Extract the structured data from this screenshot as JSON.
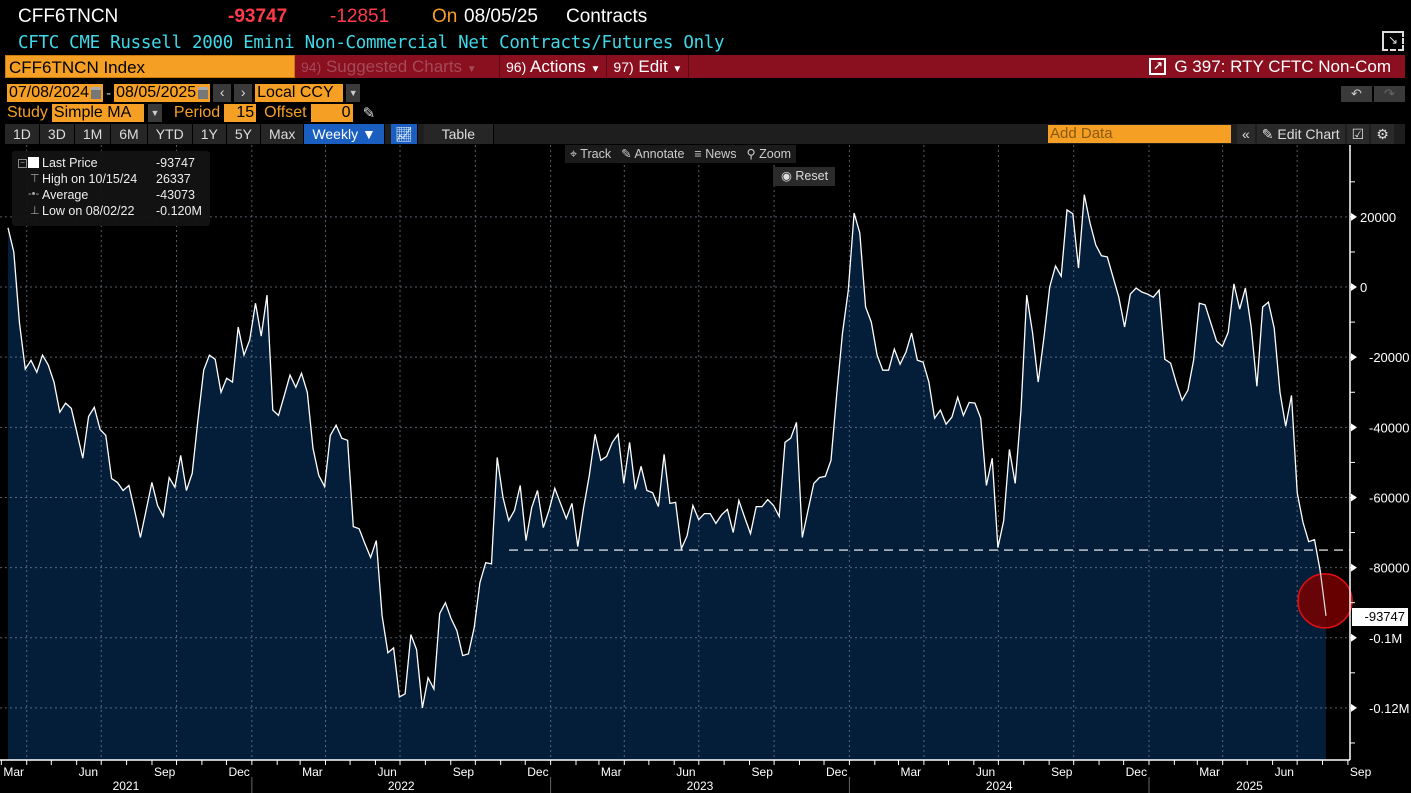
{
  "header": {
    "ticker": "CFF6TNCN",
    "last": "-93747",
    "change": "-12851",
    "on_label": "On",
    "date": "08/05/25",
    "units": "Contracts",
    "description": "CFTC CME Russell 2000 Emini Non-Commercial Net Contracts/Futures Only"
  },
  "menubar": {
    "security": "CFF6TNCN Index",
    "suggested": "Suggested Charts",
    "suggested_num": "94)",
    "actions": "Actions",
    "actions_num": "96)",
    "edit": "Edit",
    "edit_num": "97)",
    "chart_title": "G 397: RTY CFTC Non-Com"
  },
  "range": {
    "start": "07/08/2024",
    "sep": "-",
    "end": "08/05/2025",
    "currency": "Local CCY"
  },
  "study": {
    "label": "Study",
    "type": "Simple MA",
    "period_label": "Period",
    "period": "15",
    "offset_label": "Offset",
    "offset": "0"
  },
  "toolbar": {
    "periods": [
      "1D",
      "3D",
      "1M",
      "6M",
      "YTD",
      "1Y",
      "5Y",
      "Max"
    ],
    "frequency": "Weekly ▼",
    "table": "Table",
    "add_data_placeholder": "Add Data",
    "edit_chart": "Edit Chart"
  },
  "legend": [
    {
      "label": "Last Price",
      "value": "-93747"
    },
    {
      "label": "High on 10/15/24",
      "value": "26337"
    },
    {
      "label": "Average",
      "value": "-43073"
    },
    {
      "label": "Low on 08/02/22",
      "value": "-0.120M"
    }
  ],
  "chart_tools": {
    "track": "Track",
    "annotate": "Annotate",
    "news": "News",
    "zoom": "Zoom",
    "reset": "Reset"
  },
  "colors": {
    "fill": "#041e3a",
    "line": "#ffffff",
    "accent": "#f59f24",
    "menubar": "#8a0f1f",
    "negative": "#ff3b4a"
  },
  "chart_data": {
    "type": "area",
    "title": "CFTC CME Russell 2000 Emini Non-Commercial Net Contracts/Futures Only",
    "frequency": "weekly",
    "end_date": "2025-08-05",
    "ylim": [
      -134000,
      40500
    ],
    "values": [
      16900,
      10000,
      -10300,
      -23400,
      -20900,
      -24300,
      -19400,
      -22300,
      -27100,
      -35700,
      -33100,
      -34600,
      -41700,
      -48800,
      -36900,
      -34300,
      -40600,
      -42300,
      -54600,
      -55700,
      -58000,
      -56600,
      -63700,
      -71400,
      -63700,
      -55700,
      -62300,
      -65400,
      -54300,
      -57100,
      -48000,
      -58000,
      -53100,
      -38000,
      -23700,
      -19400,
      -20600,
      -30000,
      -26000,
      -27100,
      -11400,
      -19400,
      -15100,
      -4600,
      -14000,
      -2300,
      -35100,
      -36600,
      -30900,
      -25100,
      -28600,
      -24600,
      -30000,
      -46000,
      -53700,
      -56900,
      -42300,
      -39400,
      -43100,
      -43700,
      -68300,
      -68900,
      -73100,
      -77100,
      -72300,
      -93700,
      -104300,
      -102900,
      -116900,
      -116000,
      -99100,
      -103400,
      -120000,
      -111400,
      -114600,
      -93100,
      -90000,
      -94600,
      -98000,
      -105100,
      -104600,
      -97100,
      -84300,
      -78600,
      -78900,
      -48600,
      -60000,
      -66600,
      -63700,
      -56600,
      -72300,
      -62900,
      -58000,
      -68600,
      -63700,
      -57400,
      -61700,
      -66000,
      -61700,
      -74000,
      -63100,
      -53700,
      -42000,
      -49400,
      -48300,
      -44300,
      -42000,
      -56000,
      -44300,
      -57700,
      -51100,
      -58000,
      -58600,
      -62600,
      -47700,
      -61700,
      -61400,
      -74600,
      -70900,
      -62300,
      -66300,
      -64600,
      -64600,
      -67400,
      -64900,
      -63400,
      -70000,
      -60900,
      -65700,
      -70300,
      -62600,
      -62600,
      -60600,
      -62300,
      -65400,
      -44300,
      -43100,
      -38600,
      -71400,
      -63700,
      -56000,
      -54300,
      -54000,
      -49400,
      -30300,
      -13100,
      -900,
      21100,
      15400,
      -5700,
      -10000,
      -19400,
      -23700,
      -23700,
      -17700,
      -22000,
      -18600,
      -13100,
      -20900,
      -21400,
      -27100,
      -37400,
      -35100,
      -39100,
      -37100,
      -31400,
      -36600,
      -32900,
      -33100,
      -37400,
      -56600,
      -48800,
      -74300,
      -66600,
      -46300,
      -56000,
      -35100,
      -2300,
      -12900,
      -27100,
      -14300,
      0,
      6000,
      3100,
      22000,
      20900,
      5400,
      26337,
      18300,
      12000,
      8900,
      8600,
      2900,
      -2900,
      -11400,
      -2000,
      -300,
      -1400,
      -2000,
      -2900,
      -900,
      -20600,
      -21700,
      -27400,
      -32300,
      -29400,
      -20900,
      -4600,
      -5100,
      -10300,
      -15400,
      -16900,
      -12900,
      900,
      -6300,
      -300,
      -11400,
      -28300,
      -5700,
      -4300,
      -11700,
      -30000,
      -39700,
      -30900,
      -58600,
      -67100,
      -72600,
      -72000,
      -80900,
      -93747
    ],
    "reference_line": -75000,
    "last_value_tag": "-93747",
    "yticks": [
      {
        "v": 20000,
        "label": "20000"
      },
      {
        "v": 0,
        "label": "0"
      },
      {
        "v": -20000,
        "label": "-20000"
      },
      {
        "v": -40000,
        "label": "-40000"
      },
      {
        "v": -60000,
        "label": "-60000"
      },
      {
        "v": -80000,
        "label": "-80000"
      },
      {
        "v": -100000,
        "label": "-0.1M"
      },
      {
        "v": -120000,
        "label": "-0.12M"
      }
    ],
    "month_labels": [
      "Mar",
      "Jun",
      "Sep",
      "Dec"
    ],
    "years": [
      "2021",
      "2022",
      "2023",
      "2024",
      "2025"
    ]
  }
}
